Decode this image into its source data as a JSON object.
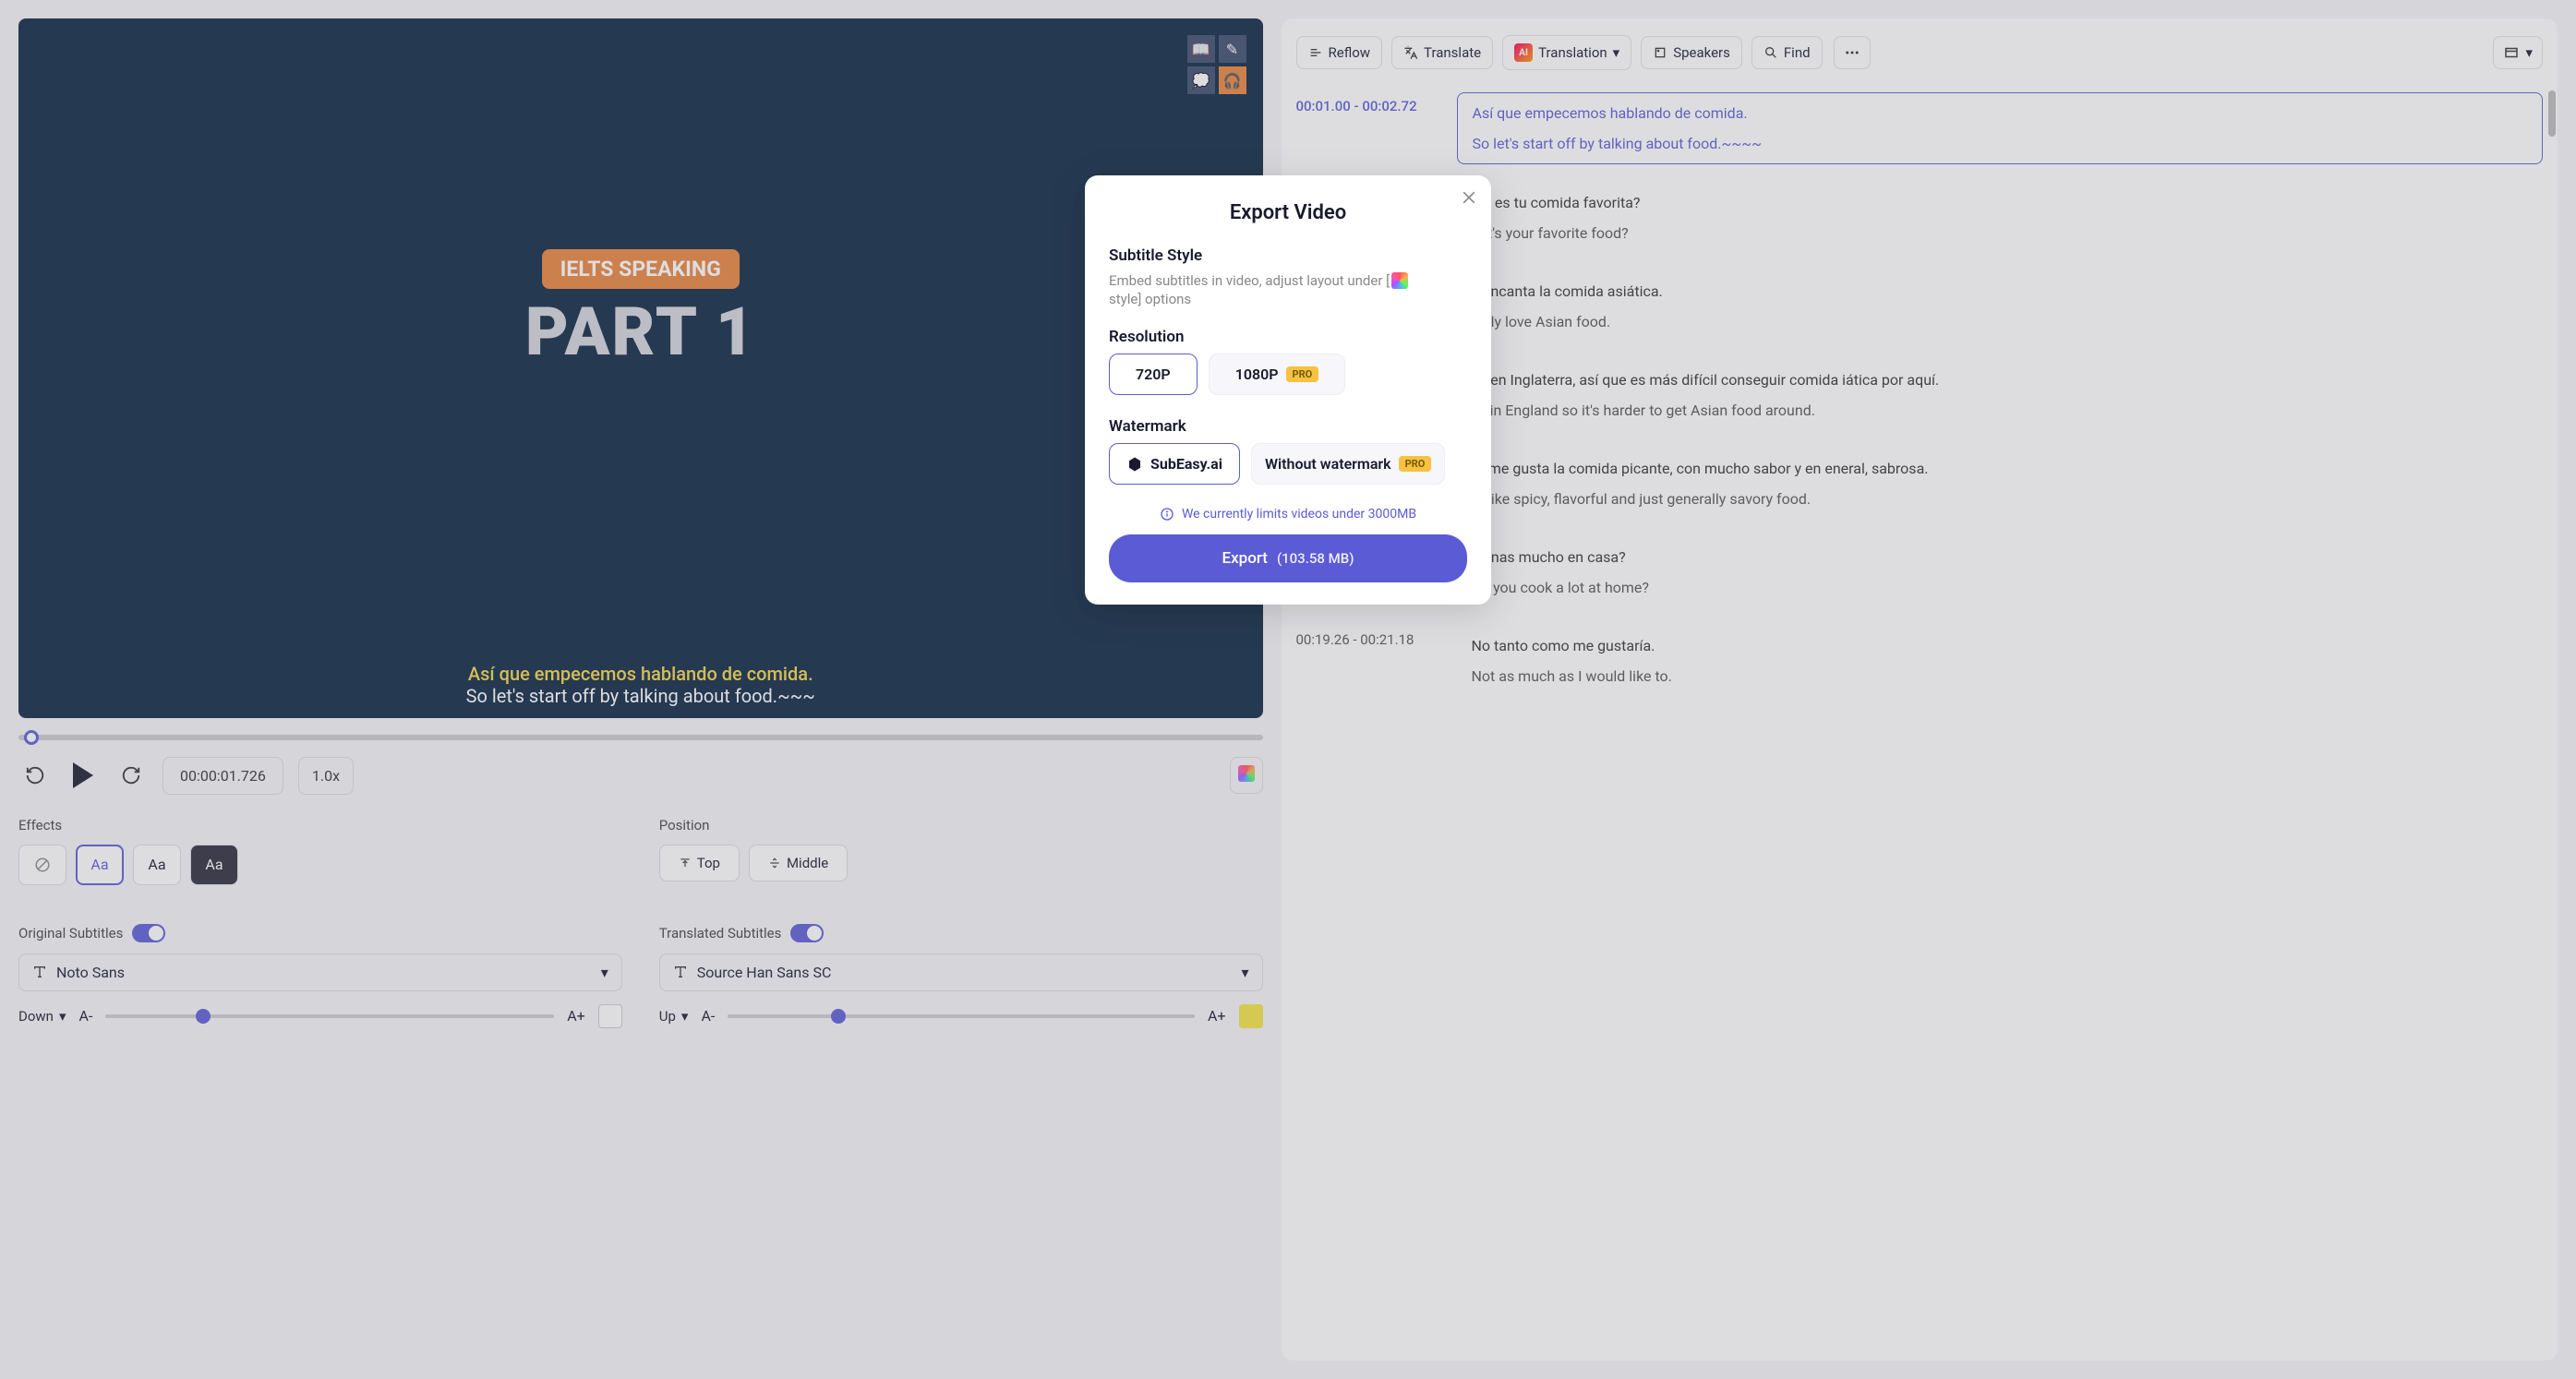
{
  "video": {
    "badge": "IELTS SPEAKING",
    "title": "PART 1",
    "subtitle_translated": "Así que empecemos hablando de comida.",
    "subtitle_original": "So let's start off by talking about food.~~~"
  },
  "player": {
    "time": "00:00:01.726",
    "speed": "1.0x"
  },
  "effects": {
    "label": "Effects",
    "opt1": "Aa",
    "opt2": "Aa",
    "opt3": "Aa"
  },
  "position": {
    "label": "Position",
    "top": "Top",
    "middle": "Middle"
  },
  "original": {
    "label": "Original Subtitles",
    "font": "Noto Sans",
    "direction": "Down",
    "minus": "A-",
    "plus": "A+"
  },
  "translated": {
    "label": "Translated Subtitles",
    "font": "Source Han Sans SC",
    "direction": "Up",
    "minus": "A-",
    "plus": "A+"
  },
  "toolbar": {
    "reflow": "Reflow",
    "translate": "Translate",
    "translation": "Translation",
    "speakers": "Speakers",
    "find": "Find"
  },
  "transcript": [
    {
      "time": "00:01.00  -  00:02.72",
      "t1": "Así que empecemos hablando de comida.",
      "t2": "So let's start off by talking about food.~~~~",
      "active": true
    },
    {
      "time": "",
      "t1": "uál es tu comida favorita?",
      "t2": "hat's your favorite food?"
    },
    {
      "time": "",
      "t1": "e encanta la comida asiática.",
      "t2": "eally love Asian food."
    },
    {
      "time": "",
      "t1": "vo en Inglaterra, así que es más difícil conseguir comida iática por aquí.",
      "t2": "ve in England so it's harder to get Asian food around."
    },
    {
      "time": "",
      "t1": "ro me gusta la comida picante, con mucho sabor y en eneral, sabrosa.",
      "t2": "t I like spicy, flavorful and just generally savory food."
    },
    {
      "time": "",
      "t1": "ocinas mucho en casa?",
      "t2": "Do you cook a lot at home?"
    },
    {
      "time": "00:19.26  -  00:21.18",
      "t1": "No tanto como me gustaría.",
      "t2": "Not as much as I would like to."
    }
  ],
  "modal": {
    "title": "Export Video",
    "subtitle_label": "Subtitle Style",
    "subtitle_hint_pre": "Embed subtitles in video, adjust layout under [",
    "subtitle_hint_mid": " style] options",
    "resolution_label": "Resolution",
    "res_720": "720P",
    "res_1080": "1080P",
    "watermark_label": "Watermark",
    "wm_brand": "SubEasy.ai",
    "wm_without": "Without watermark",
    "pro": "PRO",
    "info": "We currently limits videos under 3000MB",
    "export": "Export",
    "size": "(103.58 MB)"
  }
}
